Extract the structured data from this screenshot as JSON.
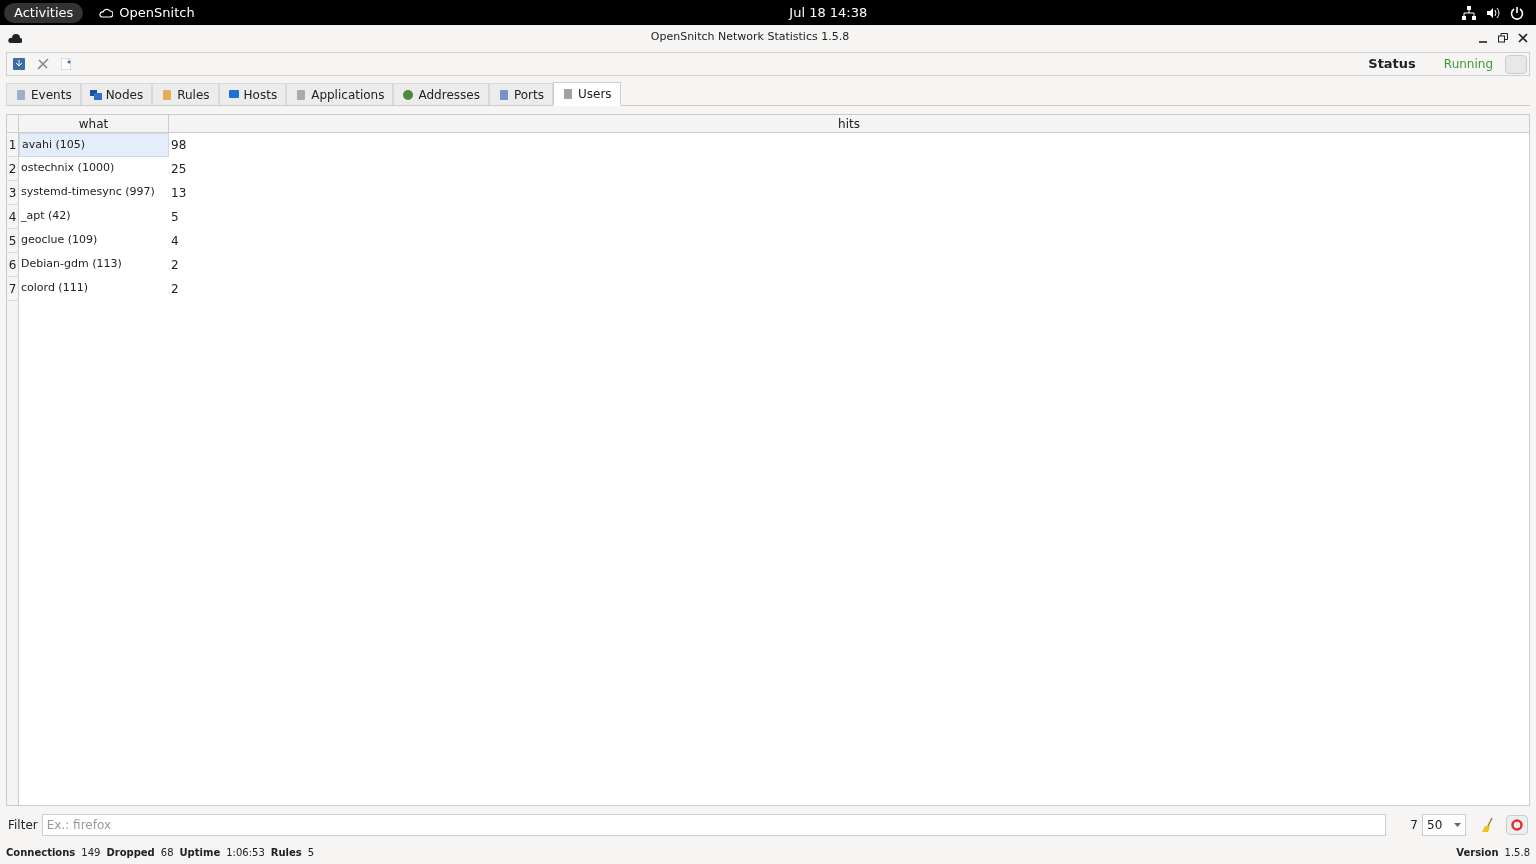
{
  "top_bar": {
    "activities": "Activities",
    "app_name": "OpenSnitch",
    "clock": "Jul 18  14:38"
  },
  "window": {
    "title": "OpenSnitch Network Statistics 1.5.8"
  },
  "toolbar": {
    "status_label": "Status",
    "status_value": "Running"
  },
  "tabs": [
    {
      "label": "Events",
      "selected": false
    },
    {
      "label": "Nodes",
      "selected": false
    },
    {
      "label": "Rules",
      "selected": false
    },
    {
      "label": "Hosts",
      "selected": false
    },
    {
      "label": "Applications",
      "selected": false
    },
    {
      "label": "Addresses",
      "selected": false
    },
    {
      "label": "Ports",
      "selected": false
    },
    {
      "label": "Users",
      "selected": true
    }
  ],
  "table": {
    "columns": [
      "what",
      "hits"
    ],
    "rows": [
      {
        "index": "1",
        "what": "avahi (105)",
        "hits": "98",
        "selected": true
      },
      {
        "index": "2",
        "what": "ostechnix (1000)",
        "hits": "25",
        "selected": false
      },
      {
        "index": "3",
        "what": "systemd-timesync (997)",
        "hits": "13",
        "selected": false
      },
      {
        "index": "4",
        "what": "_apt (42)",
        "hits": "5",
        "selected": false
      },
      {
        "index": "5",
        "what": "geoclue (109)",
        "hits": "4",
        "selected": false
      },
      {
        "index": "6",
        "what": "Debian-gdm (113)",
        "hits": "2",
        "selected": false
      },
      {
        "index": "7",
        "what": "colord (111)",
        "hits": "2",
        "selected": false
      }
    ]
  },
  "filter": {
    "label": "Filter",
    "placeholder": "Ex.: firefox",
    "count": "7",
    "limit": "50"
  },
  "status_bar": {
    "stats": [
      {
        "label": "Connections",
        "value": "149"
      },
      {
        "label": "Dropped",
        "value": "68"
      },
      {
        "label": "Uptime",
        "value": "1:06:53"
      },
      {
        "label": "Rules",
        "value": "5"
      }
    ],
    "version_label": "Version",
    "version_value": "1.5.8"
  }
}
